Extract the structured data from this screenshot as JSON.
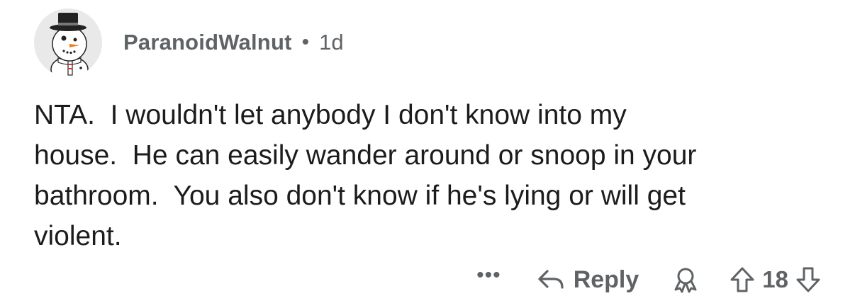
{
  "comment": {
    "author": "ParanoidWalnut",
    "separator": "•",
    "age": "1d",
    "body": "NTA.  I wouldn't let anybody I don't know into my\nhouse.  He can easily wander around or snoop in your\nbathroom.  You also don't know if he's lying or will get\nviolent.",
    "avatar_icon": "snowman-avatar-icon"
  },
  "actions": {
    "more_label": "•••",
    "reply_label": "Reply",
    "reply_icon": "reply-arrow-icon",
    "award_icon": "award-icon",
    "upvote_icon": "upvote-arrow-icon",
    "downvote_icon": "downvote-arrow-icon",
    "vote_count": "18"
  },
  "colors": {
    "text": "#1c1c1c",
    "muted": "#5f6366",
    "avatar_bg": "#e9e9e9"
  }
}
